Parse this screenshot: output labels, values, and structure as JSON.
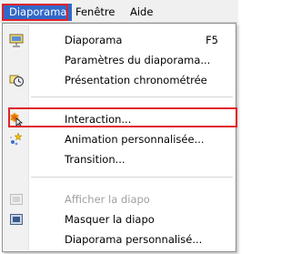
{
  "menubar": {
    "items": [
      {
        "label": "Diaporama",
        "active": true
      },
      {
        "label": "Fenêtre",
        "active": false
      },
      {
        "label": "Aide",
        "active": false
      }
    ]
  },
  "menu": {
    "items": [
      {
        "label": "Diaporama",
        "shortcut": "F5",
        "icon": "slideshow-screen-icon",
        "enabled": true
      },
      {
        "label": "Paramètres du diaporama...",
        "shortcut": "",
        "icon": "",
        "enabled": true
      },
      {
        "label": "Présentation chronométrée",
        "shortcut": "",
        "icon": "stopwatch-icon",
        "enabled": true
      },
      {
        "label": "Interaction...",
        "shortcut": "",
        "icon": "interaction-cursor-icon",
        "enabled": true,
        "highlighted": true
      },
      {
        "label": "Animation personnalisée...",
        "shortcut": "",
        "icon": "animation-star-icon",
        "enabled": true
      },
      {
        "label": "Transition...",
        "shortcut": "",
        "icon": "",
        "enabled": true
      },
      {
        "label": "Afficher la diapo",
        "shortcut": "",
        "icon": "show-slide-icon",
        "enabled": false
      },
      {
        "label": "Masquer la diapo",
        "shortcut": "",
        "icon": "hide-slide-icon",
        "enabled": true
      },
      {
        "label": "Diaporama personnalisé...",
        "shortcut": "",
        "icon": "",
        "enabled": true
      }
    ]
  },
  "colors": {
    "active_menu_bg": "#3268c8",
    "callout_border": "#e0232b",
    "disabled_text": "#a0a0a0"
  }
}
